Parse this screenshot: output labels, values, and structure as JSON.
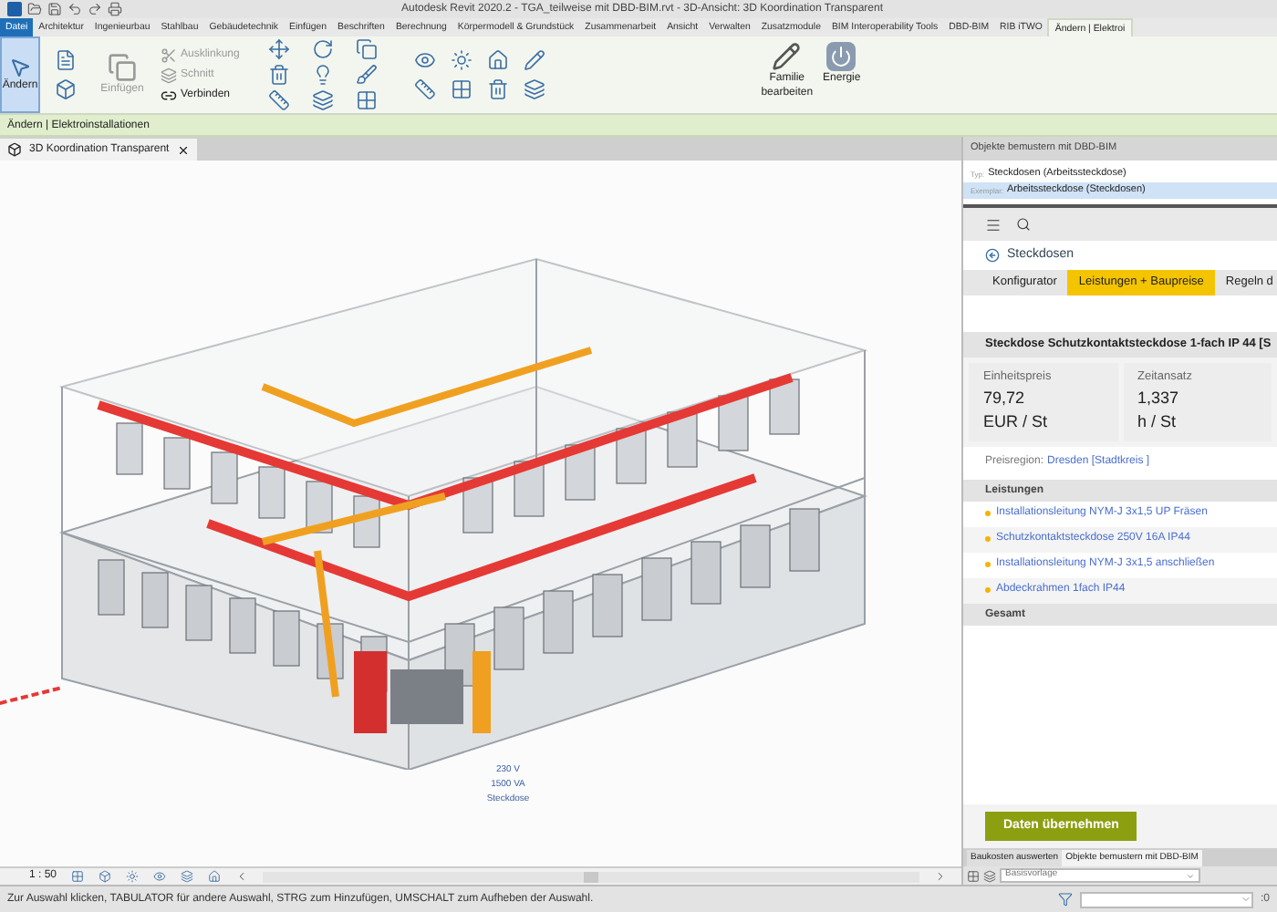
{
  "title_bar": {
    "title": "Autodesk Revit 2020.2 - TGA_teilweise mit DBD-BIM.rvt - 3D-Ansicht: 3D Koordination Transparent"
  },
  "ribbon_tabs": [
    {
      "label": "Datei",
      "selected": false,
      "kind": "file"
    },
    {
      "label": "Architektur",
      "selected": false,
      "kind": "tab"
    },
    {
      "label": "Ingenieurbau",
      "selected": false,
      "kind": "tab"
    },
    {
      "label": "Stahlbau",
      "selected": false,
      "kind": "tab"
    },
    {
      "label": "Gebäudetechnik",
      "selected": false,
      "kind": "tab"
    },
    {
      "label": "Einfügen",
      "selected": false,
      "kind": "tab"
    },
    {
      "label": "Beschriften",
      "selected": false,
      "kind": "tab"
    },
    {
      "label": "Berechnung",
      "selected": false,
      "kind": "tab"
    },
    {
      "label": "Körpermodell & Grundstück",
      "selected": false,
      "kind": "tab"
    },
    {
      "label": "Zusammenarbeit",
      "selected": false,
      "kind": "tab"
    },
    {
      "label": "Ansicht",
      "selected": false,
      "kind": "tab"
    },
    {
      "label": "Verwalten",
      "selected": false,
      "kind": "tab"
    },
    {
      "label": "Zusatzmodule",
      "selected": false,
      "kind": "tab"
    },
    {
      "label": "BIM Interoperability Tools",
      "selected": false,
      "kind": "tab"
    },
    {
      "label": "DBD-BIM",
      "selected": false,
      "kind": "tab"
    },
    {
      "label": "RIB iTWO",
      "selected": false,
      "kind": "tab"
    },
    {
      "label": "Ändern | Elektroi",
      "selected": true,
      "kind": "context"
    }
  ],
  "ribbon": {
    "modify_button": {
      "label": "Ändern",
      "selected": true
    },
    "insert_button": {
      "label": "Einfügen",
      "disabled": true
    },
    "geometry_tools": [
      {
        "label": "Ausklinkung",
        "disabled": true
      },
      {
        "label": "Schnitt",
        "disabled": true
      },
      {
        "label": "Verbinden",
        "disabled": false
      }
    ],
    "family_button": {
      "label": "Familie bearbeiten"
    },
    "energy_button": {
      "label": "Energie"
    }
  },
  "context_bar": {
    "text": "Ändern | Elektroinstallationen"
  },
  "view_tabs": [
    {
      "label": "3D Koordination Transparent",
      "selected": true
    }
  ],
  "viewport": {
    "tag_lines": [
      "230 V",
      "1500 VA",
      "Steckdose"
    ]
  },
  "view_control": {
    "scale": "1 : 50"
  },
  "status_bar": {
    "message": "Zur Auswahl klicken, TABULATOR für andere Auswahl, STRG zum Hinzufügen, UMSCHALT zum Aufheben der Auswahl.",
    "selection_count": ":0"
  },
  "panel": {
    "title": "Objekte bemustern mit DBD-BIM",
    "tree": [
      {
        "prefix": "Typ:",
        "label": "Steckdosen (Arbeitssteckdose)",
        "selected": false
      },
      {
        "prefix": "Exemplar:",
        "label": "Arbeitssteckdose (Steckdosen)",
        "selected": true
      }
    ],
    "back_link": "Steckdosen",
    "tabs": [
      {
        "label": "Konfigurator",
        "selected": false
      },
      {
        "label": "Leistungen + Baupreise",
        "selected": true
      },
      {
        "label": "Regeln d",
        "selected": false
      }
    ],
    "product_title": "Steckdose Schutzkontaktsteckdose 1-fach IP 44 [S",
    "metrics": [
      {
        "label": "Einheitspreis",
        "value": "79,72",
        "unit": "EUR / St"
      },
      {
        "label": "Zeitansatz",
        "value": "1,337",
        "unit": "h / St"
      }
    ],
    "region_label": "Preisregion:",
    "region_value": "Dresden [Stadtkreis ]",
    "services_heading": "Leistungen",
    "services": [
      "Installationsleitung NYM-J 3x1,5 UP Fräsen",
      "Schutzkontaktsteckdose 250V 16A IP44",
      "Installationsleitung NYM-J 3x1,5 anschließen",
      "Abdeckrahmen 1fach IP44"
    ],
    "total_heading": "Gesamt",
    "apply_button": "Daten übernehmen",
    "bottom_tabs": [
      {
        "label": "Baukosten auswerten",
        "selected": false
      },
      {
        "label": "Objekte bemustern mit DBD-BIM",
        "selected": true
      }
    ],
    "template_select": "Basisvorlage"
  }
}
